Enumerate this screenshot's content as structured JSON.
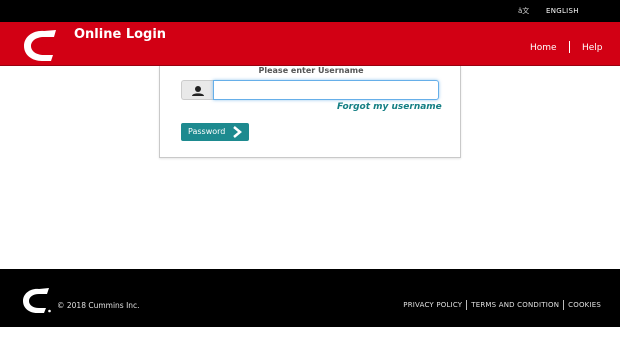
{
  "topbar": {
    "language_icon": "文",
    "language_label": "ENGLISH"
  },
  "header": {
    "title": "Online Login",
    "logo_text": "Cummins",
    "nav": {
      "home": "Home",
      "help": "Help"
    }
  },
  "login": {
    "prompt": "Please enter Username",
    "username_value": "",
    "forgot_link": "Forgot my username",
    "password_button": "Password"
  },
  "footer": {
    "copyright": "© 2018 Cummins Inc.",
    "links": {
      "privacy": "PRIVACY POLICY",
      "terms": "TERMS AND CONDITION",
      "cookies": "COOKIES"
    }
  },
  "colors": {
    "brand_red": "#d20014",
    "teal": "#1d8a8f",
    "link_teal": "#147f84",
    "black": "#000000"
  }
}
